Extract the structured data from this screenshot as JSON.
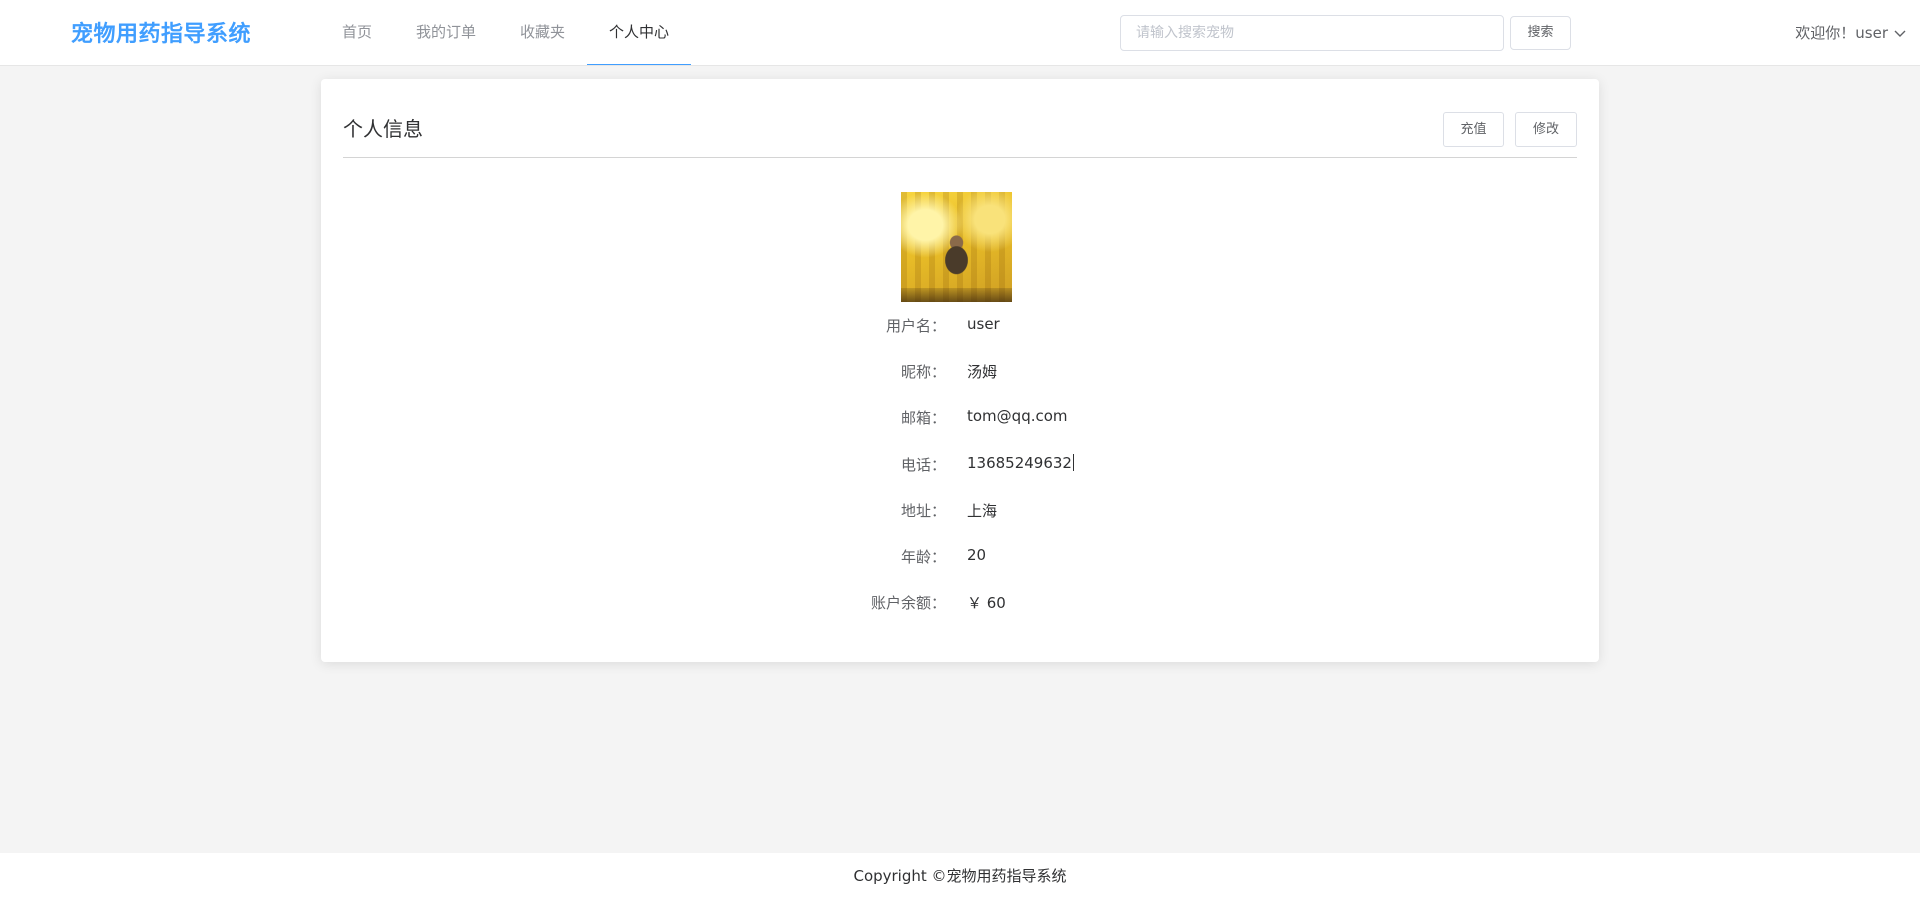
{
  "header": {
    "logo": "宠物用药指导系统",
    "nav": [
      "首页",
      "我的订单",
      "收藏夹",
      "个人中心"
    ],
    "active_nav": "个人中心",
    "search_placeholder": "请输入搜索宠物",
    "search_button": "搜索",
    "user_greeting": "欢迎你！user"
  },
  "profile": {
    "title": "个人信息",
    "recharge_button": "充值",
    "edit_button": "修改",
    "avatar": "user-avatar-photo",
    "fields": [
      {
        "label": "用户名：",
        "value": "user"
      },
      {
        "label": "昵称：",
        "value": "汤姆"
      },
      {
        "label": "邮箱：",
        "value": "tom@qq.com"
      },
      {
        "label": "电话：",
        "value": "13685249632"
      },
      {
        "label": "地址：",
        "value": "上海"
      },
      {
        "label": "年龄：",
        "value": "20"
      },
      {
        "label": "账户余额：",
        "value": "￥ 60"
      }
    ]
  },
  "footer": {
    "copyright": "Copyright ©宠物用药指导系统"
  },
  "colors": {
    "accent": "#409eff",
    "background": "#f4f4f4"
  },
  "icons": {
    "user_menu": "chevron-down-icon"
  }
}
